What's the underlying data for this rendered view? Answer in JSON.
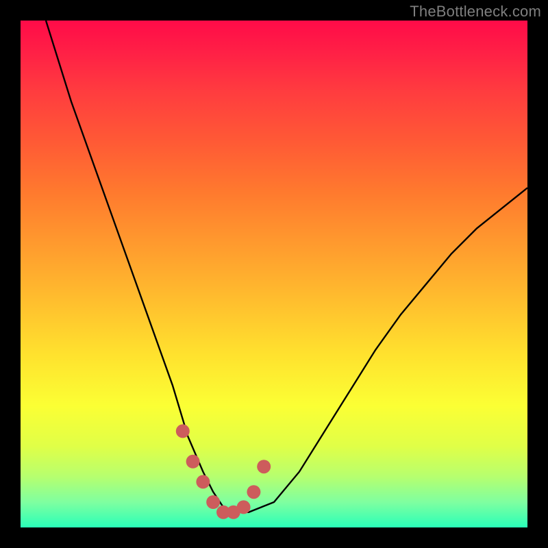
{
  "watermark": "TheBottleneck.com",
  "chart_data": {
    "type": "line",
    "title": "",
    "xlabel": "",
    "ylabel": "",
    "xlim": [
      0,
      100
    ],
    "ylim": [
      0,
      100
    ],
    "series": [
      {
        "name": "bottleneck-curve",
        "x": [
          5,
          10,
          15,
          20,
          25,
          30,
          33,
          36,
          38,
          40,
          42,
          45,
          50,
          55,
          60,
          65,
          70,
          75,
          80,
          85,
          90,
          95,
          100
        ],
        "values": [
          100,
          84,
          70,
          56,
          42,
          28,
          18,
          11,
          7,
          4,
          3,
          3,
          5,
          11,
          19,
          27,
          35,
          42,
          48,
          54,
          59,
          63,
          67
        ]
      }
    ],
    "markers": {
      "name": "marker-dots",
      "x": [
        32,
        34,
        36,
        38,
        40,
        42,
        44,
        46,
        48
      ],
      "values": [
        19,
        13,
        9,
        5,
        3,
        3,
        4,
        7,
        12
      ]
    },
    "gradient_colors": {
      "top": "#ff0b48",
      "mid": "#ffe22e",
      "bottom": "#29ffb8"
    },
    "marker_color": "#cd5c5c"
  }
}
